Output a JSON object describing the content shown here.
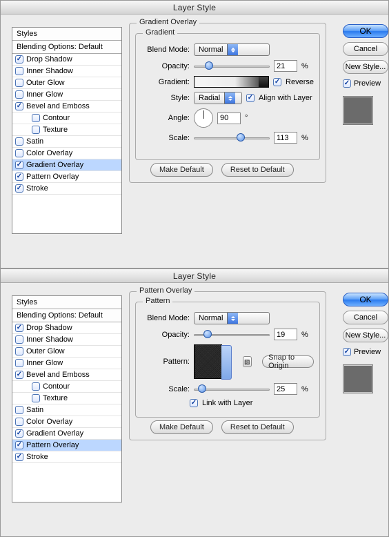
{
  "panel1": {
    "title": "Layer Style",
    "styles_header": "Styles",
    "blending_header": "Blending Options: Default",
    "styles": [
      {
        "label": "Drop Shadow",
        "checked": true,
        "selected": false,
        "indent": false
      },
      {
        "label": "Inner Shadow",
        "checked": false,
        "selected": false,
        "indent": false
      },
      {
        "label": "Outer Glow",
        "checked": false,
        "selected": false,
        "indent": false
      },
      {
        "label": "Inner Glow",
        "checked": false,
        "selected": false,
        "indent": false
      },
      {
        "label": "Bevel and Emboss",
        "checked": true,
        "selected": false,
        "indent": false
      },
      {
        "label": "Contour",
        "checked": false,
        "selected": false,
        "indent": true
      },
      {
        "label": "Texture",
        "checked": false,
        "selected": false,
        "indent": true
      },
      {
        "label": "Satin",
        "checked": false,
        "selected": false,
        "indent": false
      },
      {
        "label": "Color Overlay",
        "checked": false,
        "selected": false,
        "indent": false
      },
      {
        "label": "Gradient Overlay",
        "checked": true,
        "selected": true,
        "indent": false
      },
      {
        "label": "Pattern Overlay",
        "checked": true,
        "selected": false,
        "indent": false
      },
      {
        "label": "Stroke",
        "checked": true,
        "selected": false,
        "indent": false
      }
    ],
    "overlay_title": "Gradient Overlay",
    "fieldset_title": "Gradient",
    "labels": {
      "blend_mode": "Blend Mode:",
      "opacity": "Opacity:",
      "gradient": "Gradient:",
      "style": "Style:",
      "angle": "Angle:",
      "scale": "Scale:",
      "percent": "%",
      "degree": "°"
    },
    "values": {
      "blend_mode": "Normal",
      "opacity": "21",
      "style": "Radial",
      "angle": "90",
      "scale": "113"
    },
    "checks": {
      "reverse": "Reverse",
      "align": "Align with Layer"
    },
    "buttons": {
      "make_default": "Make Default",
      "reset_default": "Reset to Default",
      "ok": "OK",
      "cancel": "Cancel",
      "new_style": "New Style..."
    },
    "preview": "Preview"
  },
  "panel2": {
    "title": "Layer Style",
    "styles_header": "Styles",
    "blending_header": "Blending Options: Default",
    "styles": [
      {
        "label": "Drop Shadow",
        "checked": true,
        "selected": false,
        "indent": false
      },
      {
        "label": "Inner Shadow",
        "checked": false,
        "selected": false,
        "indent": false
      },
      {
        "label": "Outer Glow",
        "checked": false,
        "selected": false,
        "indent": false
      },
      {
        "label": "Inner Glow",
        "checked": false,
        "selected": false,
        "indent": false
      },
      {
        "label": "Bevel and Emboss",
        "checked": true,
        "selected": false,
        "indent": false
      },
      {
        "label": "Contour",
        "checked": false,
        "selected": false,
        "indent": true
      },
      {
        "label": "Texture",
        "checked": false,
        "selected": false,
        "indent": true
      },
      {
        "label": "Satin",
        "checked": false,
        "selected": false,
        "indent": false
      },
      {
        "label": "Color Overlay",
        "checked": false,
        "selected": false,
        "indent": false
      },
      {
        "label": "Gradient Overlay",
        "checked": true,
        "selected": false,
        "indent": false
      },
      {
        "label": "Pattern Overlay",
        "checked": true,
        "selected": true,
        "indent": false
      },
      {
        "label": "Stroke",
        "checked": true,
        "selected": false,
        "indent": false
      }
    ],
    "overlay_title": "Pattern Overlay",
    "fieldset_title": "Pattern",
    "labels": {
      "blend_mode": "Blend Mode:",
      "opacity": "Opacity:",
      "pattern": "Pattern:",
      "scale": "Scale:",
      "percent": "%"
    },
    "values": {
      "blend_mode": "Normal",
      "opacity": "19",
      "scale": "25"
    },
    "checks": {
      "link": "Link with Layer"
    },
    "buttons": {
      "snap": "Snap to Origin",
      "make_default": "Make Default",
      "reset_default": "Reset to Default",
      "ok": "OK",
      "cancel": "Cancel",
      "new_style": "New Style..."
    },
    "preview": "Preview"
  }
}
